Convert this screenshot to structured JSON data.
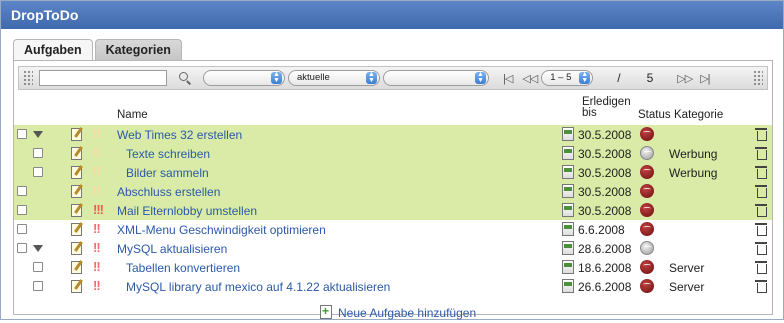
{
  "app": {
    "title": "DropToDo"
  },
  "tabs": [
    {
      "label": "Aufgaben",
      "active": false
    },
    {
      "label": "Kategorien",
      "active": true
    }
  ],
  "toolbar": {
    "search": {
      "value": "",
      "placeholder": ""
    },
    "filter1": {
      "value": ""
    },
    "filter2": {
      "value": "aktuelle"
    },
    "filter3": {
      "value": ""
    },
    "first_label": "|◁",
    "prev_label": "◁◁",
    "range": {
      "value": "1 – 5"
    },
    "separator": "/",
    "total": "5",
    "next_label": "▷▷",
    "last_label": "▷|"
  },
  "columns": {
    "name": "Name",
    "due": "Erledigen bis",
    "status": "Status",
    "category": "Kategorie"
  },
  "tasks": [
    {
      "name": "Web Times 32 erstellen",
      "due": "30.5.2008",
      "status": "red",
      "category": "",
      "priority": "!!",
      "prio_level": 1,
      "indent": 0,
      "expandable": true,
      "highlight": true
    },
    {
      "name": "Texte schreiben",
      "due": "30.5.2008",
      "status": "grey",
      "category": "Werbung",
      "priority": "!!",
      "prio_level": 1,
      "indent": 1,
      "expandable": false,
      "highlight": true
    },
    {
      "name": "Bilder sammeln",
      "due": "30.5.2008",
      "status": "red",
      "category": "Werbung",
      "priority": "!!",
      "prio_level": 1,
      "indent": 1,
      "expandable": false,
      "highlight": true
    },
    {
      "name": "Abschluss erstellen",
      "due": "30.5.2008",
      "status": "red",
      "category": "",
      "priority": "!!",
      "prio_level": 1,
      "indent": 0,
      "expandable": false,
      "highlight": true
    },
    {
      "name": "Mail Elternlobby umstellen",
      "due": "30.5.2008",
      "status": "red",
      "category": "",
      "priority": "!!!",
      "prio_level": 3,
      "indent": 0,
      "expandable": false,
      "highlight": true
    },
    {
      "name": "XML-Menu Geschwindigkeit optimieren",
      "due": "6.6.2008",
      "status": "red",
      "category": "",
      "priority": "!!",
      "prio_level": 2,
      "indent": 0,
      "expandable": false,
      "highlight": false
    },
    {
      "name": "MySQL aktualisieren",
      "due": "28.6.2008",
      "status": "grey",
      "category": "",
      "priority": "!!",
      "prio_level": 2,
      "indent": 0,
      "expandable": true,
      "highlight": false
    },
    {
      "name": "Tabellen konvertieren",
      "due": "18.6.2008",
      "status": "red",
      "category": "Server",
      "priority": "!!",
      "prio_level": 2,
      "indent": 1,
      "expandable": false,
      "highlight": false
    },
    {
      "name": "MySQL library auf mexico auf 4.1.22 aktualisieren",
      "due": "26.6.2008",
      "status": "red",
      "category": "Server",
      "priority": "!!",
      "prio_level": 2,
      "indent": 1,
      "expandable": false,
      "highlight": false
    }
  ],
  "add_task_label": "Neue Aufgabe hinzufügen"
}
